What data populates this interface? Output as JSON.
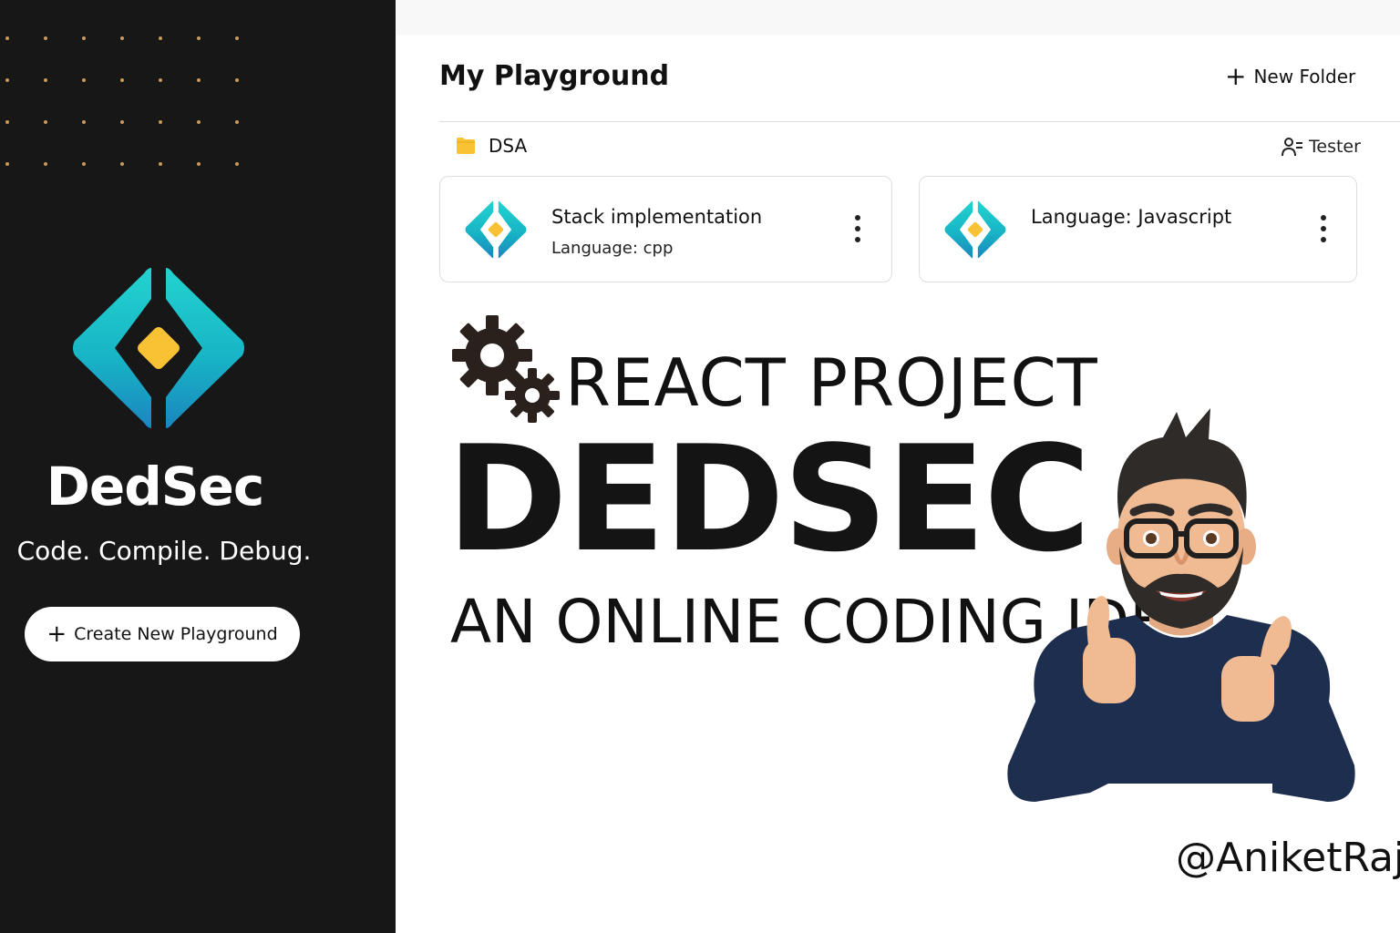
{
  "sidebar": {
    "brand_name": "DedSec",
    "tagline": "Code. Compile. Debug.",
    "create_button_label": "Create New Playground"
  },
  "main": {
    "title": "My Playground",
    "new_folder_label": "New Folder",
    "folder": {
      "name": "DSA",
      "owner_label": "Tester",
      "cards": [
        {
          "title": "Stack implementation",
          "subtitle": "Language: cpp"
        },
        {
          "title": "Language: Javascript",
          "subtitle": ""
        }
      ]
    }
  },
  "banner": {
    "line1": "REACT PROJECT",
    "headline": "DEDSEC",
    "line3": "AN ONLINE CODING IDE",
    "handle": "@AniketRaj"
  },
  "colors": {
    "sidebar_bg": "#171717",
    "logo_teal": "#1cc7c9",
    "logo_blue": "#1a8fc0",
    "logo_gem": "#f8c234",
    "folder_yellow": "#f8c234",
    "dot_accent": "#c89a5c"
  },
  "icons": [
    "dedsec-logo-icon",
    "plus-icon",
    "folder-icon",
    "user-list-icon",
    "kebab-menu-icon",
    "gears-icon",
    "memoji-avatar"
  ]
}
